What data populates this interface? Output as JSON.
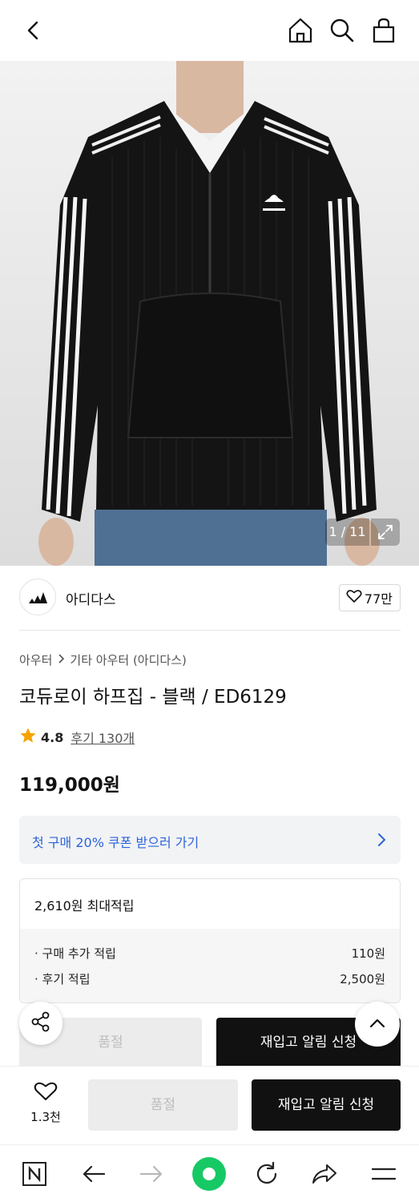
{
  "header": {
    "icons": [
      "back-icon",
      "home-icon",
      "search-icon",
      "shopping-bag-icon"
    ]
  },
  "gallery": {
    "counter": "1 / 11",
    "expand_icon": "expand-icon"
  },
  "brand": {
    "name": "아디다스",
    "likes": "77만"
  },
  "product": {
    "breadcrumb": [
      "아우터",
      "기타 아우터 (아디다스)"
    ],
    "title": "코듀로이 하프집 - 블랙 / ED6129",
    "rating": "4.8",
    "review_link": "후기 130개",
    "price": "119,000원"
  },
  "coupon": {
    "text": "첫 구매 20% 쿠폰 받으러 가기"
  },
  "points": {
    "max_label": "2,610원 최대적립",
    "rows": [
      {
        "label": "· 구매 추가 적립",
        "value": "110원"
      },
      {
        "label": "· 후기 적립",
        "value": "2,500원"
      }
    ]
  },
  "inline_buttons": {
    "soldout": "품절",
    "restock": "재입고 알림 신청"
  },
  "bottom_bar": {
    "wish_count": "1.3천",
    "soldout": "품절",
    "restock": "재입고 알림 신청"
  },
  "colors": {
    "accent_blue": "#2b63d9",
    "star": "#f5a300",
    "browser_green": "#17c964",
    "dark_button": "#111111"
  }
}
